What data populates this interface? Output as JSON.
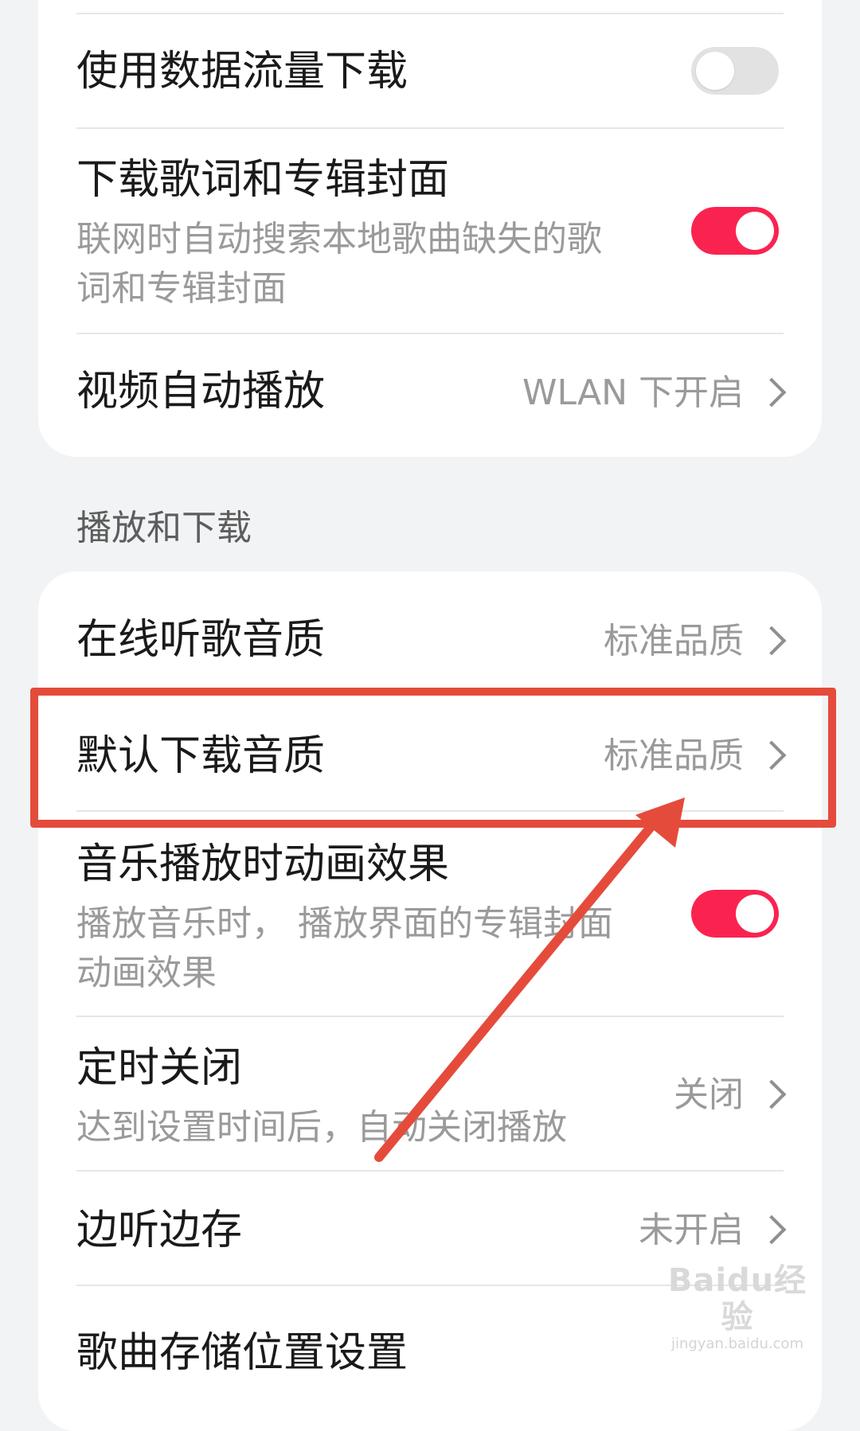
{
  "settings_top": {
    "mobile_data_download": {
      "label": "使用数据流量下载",
      "enabled": false
    },
    "lyrics_cover_download": {
      "label": "下载歌词和专辑封面",
      "description": "联网时自动搜索本地歌曲缺失的歌词和专辑封面",
      "enabled": true
    },
    "video_autoplay": {
      "label": "视频自动播放",
      "value": "WLAN 下开启"
    }
  },
  "section_playback": {
    "header": "播放和下载",
    "online_quality": {
      "label": "在线听歌音质",
      "value": "标准品质"
    },
    "default_download_quality": {
      "label": "默认下载音质",
      "value": "标准品质"
    },
    "playback_animation": {
      "label": "音乐播放时动画效果",
      "description": "播放音乐时， 播放界面的专辑封面动画效果",
      "enabled": true
    },
    "sleep_timer": {
      "label": "定时关闭",
      "description": "达到设置时间后，自动关闭播放",
      "value": "关闭"
    },
    "cache_while_listening": {
      "label": "边听边存",
      "value": "未开启"
    },
    "storage_location": {
      "label": "歌曲存储位置设置"
    }
  },
  "annotation": {
    "highlight_color": "#e54b3b"
  },
  "watermark": {
    "logo": "Baidu经验",
    "url": "jingyan.baidu.com"
  },
  "colors": {
    "toggle_on": "#fa2350",
    "toggle_off": "#e2e2e2",
    "background": "#f1f3f5",
    "card": "#ffffff"
  }
}
